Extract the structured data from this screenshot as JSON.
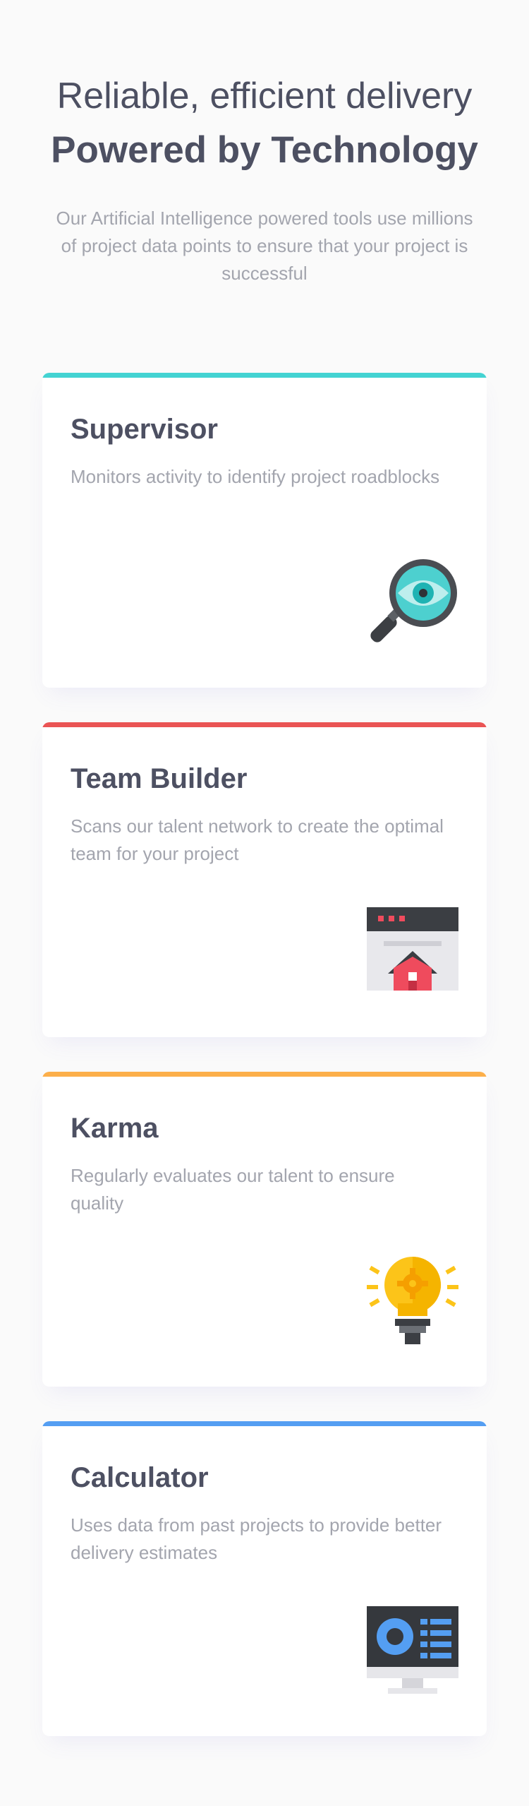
{
  "header": {
    "title_light": "Reliable, efficient delivery",
    "title_bold": "Powered by Technology",
    "subtitle": "Our Artificial Intelligence powered tools use millions of project data points to ensure that your project is successful"
  },
  "cards": [
    {
      "title": "Supervisor",
      "description": "Monitors activity to identify project roadblocks",
      "accent_color": "#44d3d2",
      "icon": "magnifier-eye-icon"
    },
    {
      "title": "Team Builder",
      "description": "Scans our talent network to create the optimal team for your project",
      "accent_color": "#ea5454",
      "icon": "browser-home-icon"
    },
    {
      "title": "Karma",
      "description": "Regularly evaluates our talent to ensure quality",
      "accent_color": "#fcaf4a",
      "icon": "lightbulb-gear-icon"
    },
    {
      "title": "Calculator",
      "description": "Uses data from past projects to provide better delivery estimates",
      "accent_color": "#549ef2",
      "icon": "monitor-chart-icon"
    }
  ]
}
